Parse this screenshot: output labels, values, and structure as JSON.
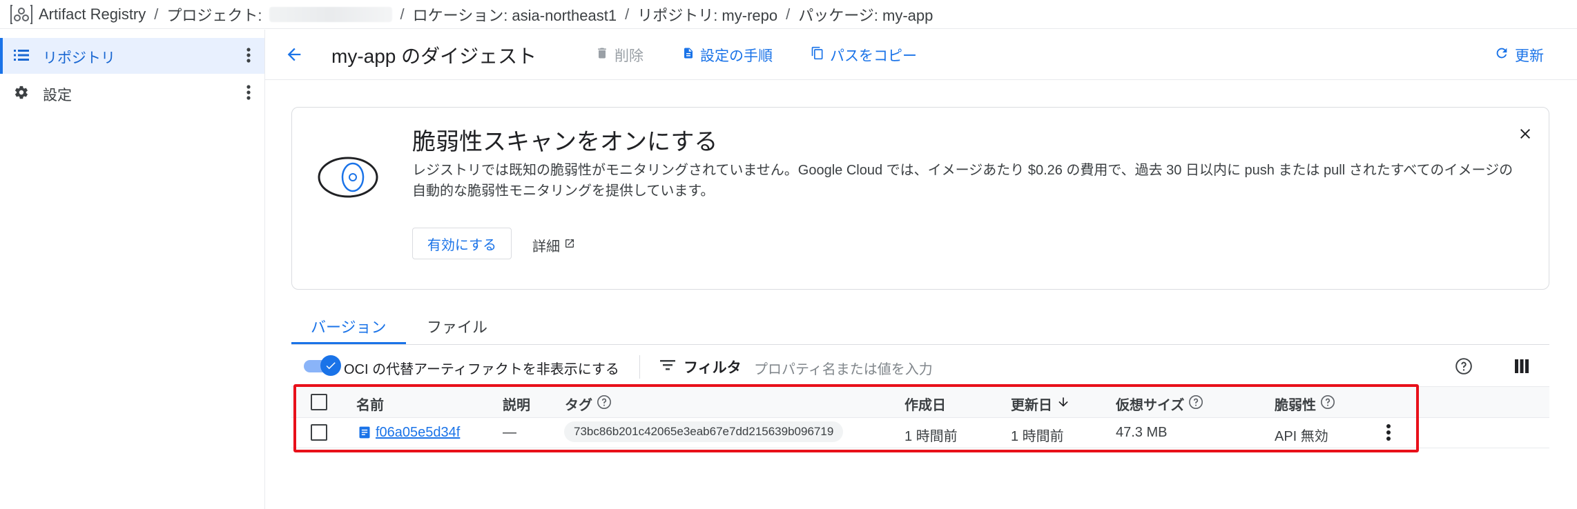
{
  "breadcrumb": {
    "app": "Artifact Registry",
    "project_label": "プロジェクト:",
    "location": "ロケーション: asia-northeast1",
    "repository": "リポジトリ: my-repo",
    "package": "パッケージ: my-app",
    "separator": "/"
  },
  "sidebar": {
    "items": [
      {
        "label": "リポジトリ",
        "icon": "list-icon",
        "active": true
      },
      {
        "label": "設定",
        "icon": "gear-icon",
        "active": false
      }
    ]
  },
  "header": {
    "title": "my-app のダイジェスト",
    "delete_label": "削除",
    "setup_label": "設定の手順",
    "copy_path_label": "パスをコピー",
    "refresh_label": "更新"
  },
  "banner": {
    "title": "脆弱性スキャンをオンにする",
    "description": "レジストリでは既知の脆弱性がモニタリングされていません。Google Cloud では、イメージあたり $0.26 の費用で、過去 30 日以内に push または pull されたすべてのイメージの自動的な脆弱性モニタリングを提供しています。",
    "enable_label": "有効にする",
    "details_label": "詳細"
  },
  "tabs": [
    {
      "label": "バージョン",
      "active": true
    },
    {
      "label": "ファイル",
      "active": false
    }
  ],
  "toolbar": {
    "toggle_label": "OCI の代替アーティファクトを非表示にする",
    "toggle_on": true,
    "filter_label": "フィルタ",
    "filter_placeholder": "プロパティ名または値を入力"
  },
  "table": {
    "columns": [
      "名前",
      "説明",
      "タグ",
      "作成日",
      "更新日",
      "仮想サイズ",
      "脆弱性"
    ],
    "rows": [
      {
        "name": "f06a05e5d34f",
        "description": "—",
        "tag": "73bc86b201c42065e3eab67e7dd215639b096719",
        "created": "1 時間前",
        "updated": "1 時間前",
        "size": "47.3 MB",
        "vulnerability": "API 無効"
      }
    ]
  },
  "colors": {
    "accent": "#1a73e8",
    "highlight_box": "#e8101a"
  }
}
